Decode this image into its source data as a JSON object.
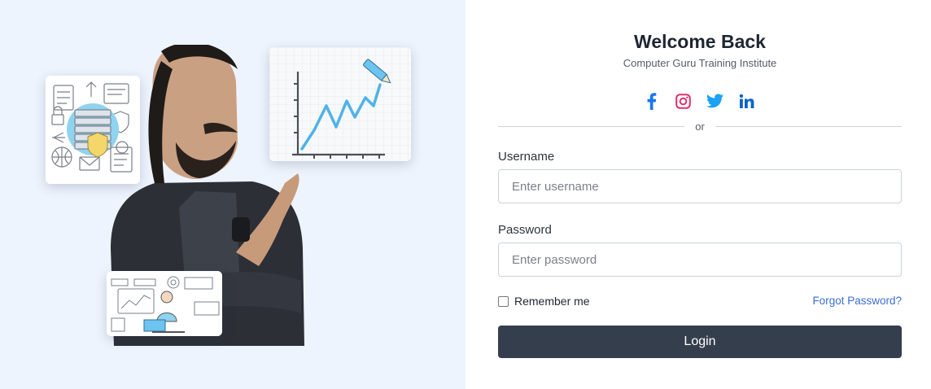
{
  "hero": {
    "cards": [
      "security-illustration",
      "growth-chart-illustration",
      "analyst-illustration"
    ]
  },
  "login": {
    "title": "Welcome Back",
    "subtitle": "Computer Guru Training Institute",
    "socials": [
      {
        "icon": "facebook-icon",
        "color": "#1877f2"
      },
      {
        "icon": "instagram-icon",
        "color": "#e1306c"
      },
      {
        "icon": "twitter-icon",
        "color": "#1da1f2"
      },
      {
        "icon": "linkedin-icon",
        "color": "#0a66c2"
      }
    ],
    "divider_text": "or",
    "username": {
      "label": "Username",
      "placeholder": "Enter username",
      "value": ""
    },
    "password": {
      "label": "Password",
      "placeholder": "Enter password",
      "value": ""
    },
    "remember_label": "Remember me",
    "remember_checked": false,
    "forgot_label": "Forgot Password?",
    "submit_label": "Login"
  },
  "colors": {
    "hero_background": "#eef4fd",
    "button": "#353e4d",
    "link": "#3b6ed6",
    "accent_chart": "#4fb3e8"
  }
}
